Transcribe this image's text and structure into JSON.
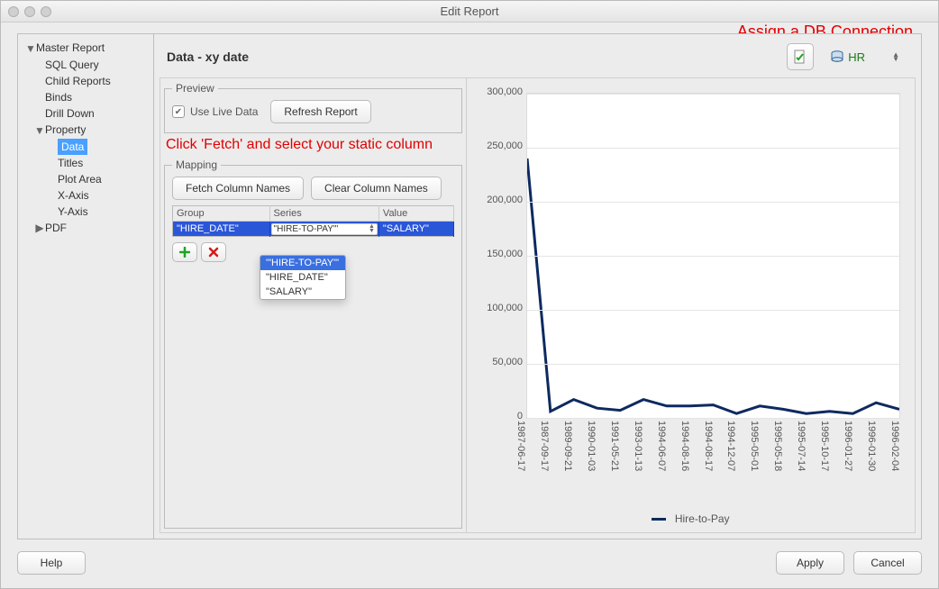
{
  "window": {
    "title": "Edit Report"
  },
  "annotations": {
    "assign_db": "Assign a DB Connection",
    "fetch_hint": "Click 'Fetch' and select your static column"
  },
  "tree": {
    "master": "Master Report",
    "sql": "SQL Query",
    "child": "Child Reports",
    "binds": "Binds",
    "drill": "Drill Down",
    "property": "Property",
    "data": "Data",
    "titles": "Titles",
    "plot": "Plot Area",
    "xaxis": "X-Axis",
    "yaxis": "Y-Axis",
    "pdf": "PDF"
  },
  "header": {
    "title": "Data - xy date",
    "db_label": "HR"
  },
  "preview": {
    "legend": "Preview",
    "use_live": "Use Live Data",
    "refresh": "Refresh Report"
  },
  "mapping": {
    "legend": "Mapping",
    "fetch": "Fetch Column Names",
    "clear": "Clear Column Names",
    "cols": {
      "group": "Group",
      "series": "Series",
      "value": "Value"
    },
    "row": {
      "group": "\"HIRE_DATE\"",
      "series": "\"HIRE-TO-PAY\"'",
      "value": "\"SALARY\""
    },
    "dropdown": {
      "opt0": "'\"HIRE-TO-PAY\"'",
      "opt1": "\"HIRE_DATE\"",
      "opt2": "\"SALARY\""
    }
  },
  "footer": {
    "help": "Help",
    "apply": "Apply",
    "cancel": "Cancel"
  },
  "chart_data": {
    "type": "line",
    "title": "",
    "xlabel": "",
    "ylabel": "",
    "ylim": [
      0,
      300000
    ],
    "yticks": [
      0,
      50000,
      100000,
      150000,
      200000,
      250000,
      300000
    ],
    "categories": [
      "1987-06-17",
      "1987-09-17",
      "1989-09-21",
      "1990-01-03",
      "1991-05-21",
      "1993-01-13",
      "1994-06-07",
      "1994-08-16",
      "1994-08-17",
      "1994-12-07",
      "1995-05-01",
      "1995-05-18",
      "1995-07-14",
      "1995-10-17",
      "1996-01-27",
      "1996-01-30",
      "1996-02-04"
    ],
    "series": [
      {
        "name": "Hire-to-Pay",
        "values": [
          240000,
          6000,
          17000,
          9000,
          7000,
          17000,
          11000,
          11000,
          12000,
          4000,
          11000,
          8000,
          4000,
          6000,
          4000,
          14000,
          8000
        ]
      }
    ]
  }
}
